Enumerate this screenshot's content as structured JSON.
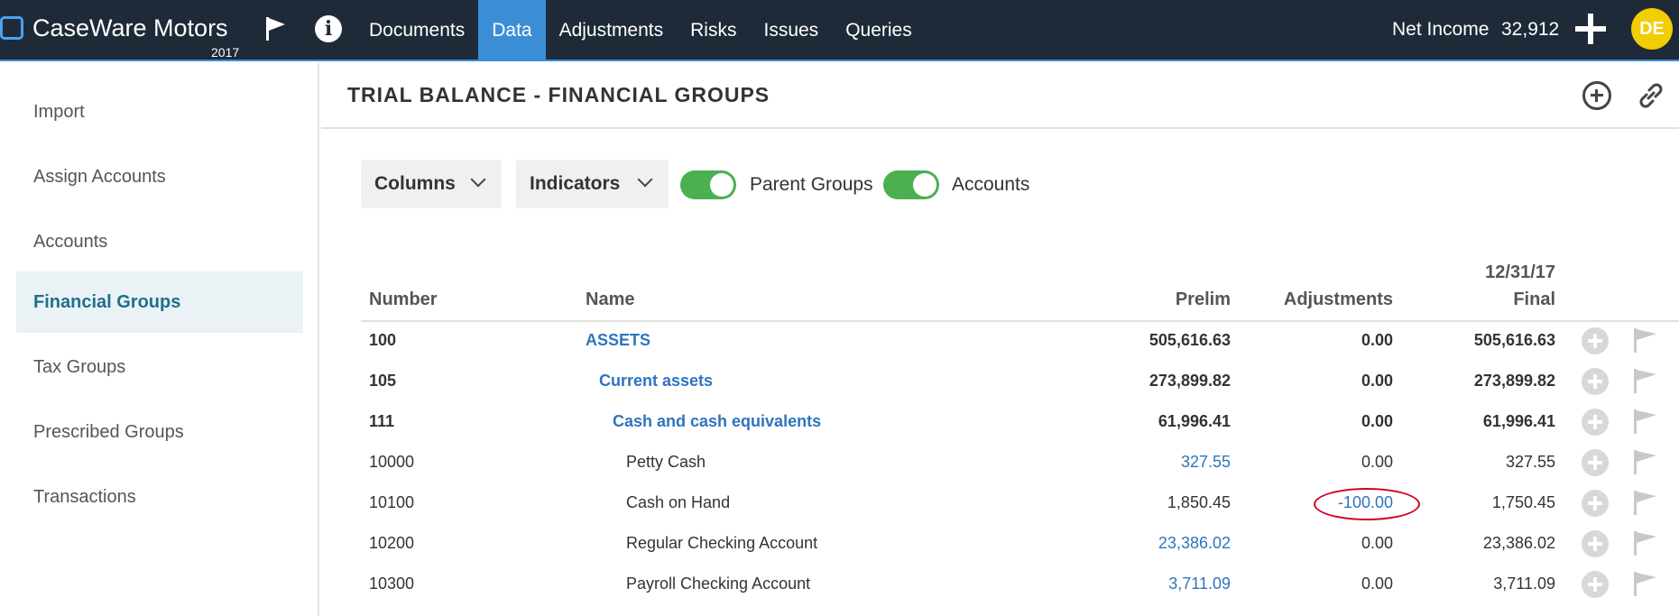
{
  "topbar": {
    "app_name": "CaseWare Motors",
    "year": "2017",
    "nav": [
      "Documents",
      "Data",
      "Adjustments",
      "Risks",
      "Issues",
      "Queries"
    ],
    "active_nav": "Data",
    "net_income_label": "Net Income",
    "net_income_value": "32,912",
    "avatar_initials": "DE",
    "icons": [
      "flag-icon",
      "info-icon",
      "add-icon"
    ]
  },
  "sidebar": {
    "items": [
      "Import",
      "Assign Accounts",
      "Accounts",
      "Financial Groups",
      "Tax Groups",
      "Prescribed Groups",
      "Transactions"
    ],
    "active": "Financial Groups"
  },
  "page": {
    "title": "TRIAL BALANCE - FINANCIAL GROUPS",
    "columns_label": "Columns",
    "indicators_label": "Indicators",
    "parent_groups_label": "Parent Groups",
    "accounts_label": "Accounts",
    "parent_groups_on": true,
    "accounts_on": true
  },
  "table": {
    "headers": {
      "number": "Number",
      "name": "Name",
      "prelim": "Prelim",
      "adjustments": "Adjustments",
      "final_date": "12/31/17",
      "final": "Final"
    },
    "rows": [
      {
        "number": "100",
        "name": "ASSETS",
        "prelim": "505,616.63",
        "adjustments": "0.00",
        "final": "505,616.63"
      },
      {
        "number": "105",
        "name": "Current assets",
        "prelim": "273,899.82",
        "adjustments": "0.00",
        "final": "273,899.82"
      },
      {
        "number": "111",
        "name": "Cash and cash equivalents",
        "prelim": "61,996.41",
        "adjustments": "0.00",
        "final": "61,996.41"
      },
      {
        "number": "10000",
        "name": "Petty Cash",
        "prelim": "327.55",
        "adjustments": "0.00",
        "final": "327.55"
      },
      {
        "number": "10100",
        "name": "Cash on Hand",
        "prelim": "1,850.45",
        "adjustments": "-100.00",
        "final": "1,750.45"
      },
      {
        "number": "10200",
        "name": "Regular Checking Account",
        "prelim": "23,386.02",
        "adjustments": "0.00",
        "final": "23,386.02"
      },
      {
        "number": "10300",
        "name": "Payroll Checking Account",
        "prelim": "3,711.09",
        "adjustments": "0.00",
        "final": "3,711.09"
      }
    ]
  },
  "colors": {
    "topbar_bg": "#1e2a38",
    "accent": "#3b8ed6",
    "link_blue": "#2f74c0",
    "toggle_green": "#4caf50",
    "avatar_yellow": "#f2cd00",
    "annotation_red": "#d0021b"
  }
}
